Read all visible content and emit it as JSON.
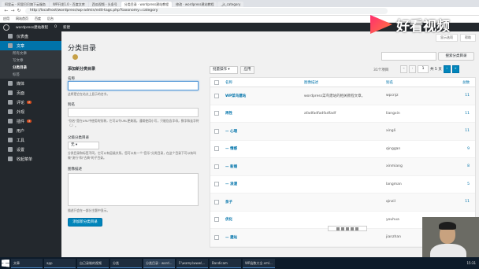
{
  "browser": {
    "tabs": [
      {
        "label": "阿里云 - 阿里巴巴旗下云服务",
        "active": false
      },
      {
        "label": "WP开发1.0 - 百度文库",
        "active": false
      },
      {
        "label": "西瓜视频 - 头条号",
        "active": false
      },
      {
        "label": "分类目录 · wordpress建站教程",
        "active": true
      },
      {
        "label": "修改 · wordpress建站教程",
        "active": false
      },
      {
        "label": "_js_category",
        "active": false
      }
    ],
    "url": "http://localhost/wordpress/wp-admin/edit-tags.php?taxonomy=category",
    "bookmarks": [
      "应用",
      "网站首页",
      "百度",
      "后台"
    ]
  },
  "adminbar": {
    "site_name": "wordpress建站教程",
    "comments": "0",
    "new_label": "新建"
  },
  "sidebar": {
    "items": [
      {
        "label": "仪表盘",
        "icon": "dashboard-icon"
      },
      {
        "label": "文章",
        "icon": "pin-icon",
        "current": true
      },
      {
        "label": "媒体",
        "icon": "media-icon"
      },
      {
        "label": "页面",
        "icon": "page-icon"
      },
      {
        "label": "评论",
        "icon": "comment-icon",
        "badge": "2"
      },
      {
        "label": "外观",
        "icon": "brush-icon"
      },
      {
        "label": "插件",
        "icon": "plugin-icon",
        "badge": "3"
      },
      {
        "label": "用户",
        "icon": "user-icon"
      },
      {
        "label": "工具",
        "icon": "wrench-icon"
      },
      {
        "label": "设置",
        "icon": "settings-icon"
      },
      {
        "label": "收起菜单",
        "icon": "collapse-icon"
      }
    ],
    "sub_items": [
      "所有文章",
      "写文章",
      "分类目录",
      "标签"
    ]
  },
  "page": {
    "title": "分类目录",
    "screen_options": "显示选项",
    "help": "帮助",
    "search_button": "搜索分类目录",
    "add_title": "添加新分类目录",
    "name_label": "名称",
    "name_hint": "这将是它在站点上显示的名字。",
    "slug_label": "别名",
    "slug_hint": "\"别名\"是在URL中使用的别称，它可以令URL更美观。通常使用小写，只能包含字母，数字和连字符（-）。",
    "parent_label": "父级分类目录",
    "parent_value": "无",
    "parent_hint": "分类目录和标签不同，它可以有层级关系。您可以有一个\"音乐\"分类目录，在这个目录下可以有叫做\"流行\"和\"古典\"的子目录。",
    "desc_label": "图像描述",
    "desc_hint": "描述只会在一部分主题中显示。",
    "add_button": "添加新分类目录",
    "bulk_label": "批量操作",
    "apply_label": "应用",
    "count_text": "31个项目",
    "pager": {
      "first": "«",
      "prev": "‹",
      "current": "1",
      "of": "共 5 页",
      "next": "›",
      "last": "»"
    }
  },
  "table": {
    "headers": {
      "name": "名称",
      "desc": "图像描述",
      "slug": "别名",
      "count": "总数"
    },
    "rows": [
      {
        "name": "WP菜鸟建站",
        "desc": "wordpress菜鸟建站的相关教程文章。",
        "slug": "wpcnjz",
        "count": "11"
      },
      {
        "name": "再性",
        "desc": "afadfadfadfadfadf",
        "slug": "liangxin",
        "count": "11"
      },
      {
        "name": "— 心理",
        "desc": "",
        "slug": "xingli",
        "count": "11"
      },
      {
        "name": "— 情感",
        "desc": "",
        "slug": "qinggan",
        "count": "9"
      },
      {
        "name": "— 新婚",
        "desc": "",
        "slug": "xinmiang",
        "count": "8"
      },
      {
        "name": "— 浪漫",
        "desc": "",
        "slug": "langman",
        "count": "5"
      },
      {
        "name": "亲子",
        "desc": "",
        "slug": "qinzil",
        "count": "11"
      },
      {
        "name": "优化",
        "desc": "",
        "slug": "youhua",
        "count": "11"
      },
      {
        "name": "— 建站",
        "desc": "",
        "slug": "jianzhan",
        "count": "11"
      }
    ]
  },
  "overlay": {
    "logo_text": "好看视频"
  },
  "taskbar": {
    "items": [
      "文章",
      "app",
      "自己录制的视频",
      "分类",
      "分类目录 · word...",
      "F:\\wamp\\www\\...",
      "Bandicam",
      "WP函数大全.xml..."
    ],
    "clock": "15:31"
  }
}
